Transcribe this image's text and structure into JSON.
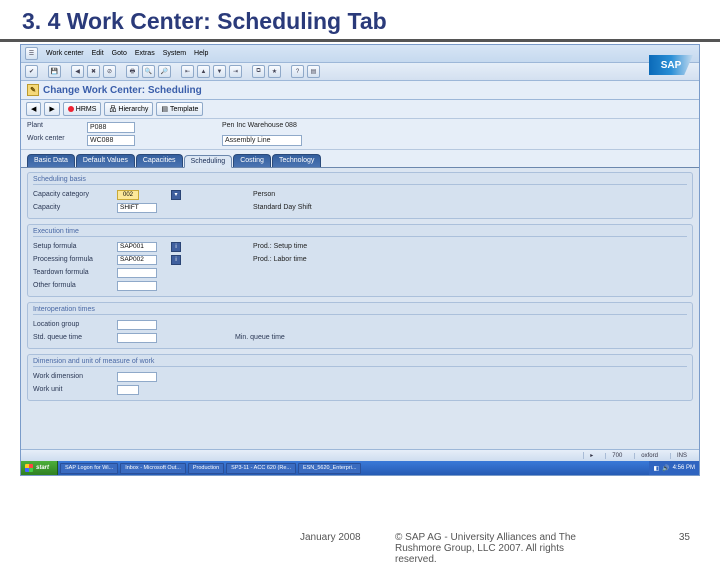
{
  "slide": {
    "title": "3. 4 Work Center: Scheduling Tab"
  },
  "menubar": {
    "sys_icon": "☰",
    "items": [
      "Work center",
      "Edit",
      "Goto",
      "Extras",
      "System",
      "Help"
    ]
  },
  "logo": "SAP",
  "page_header": {
    "icon_glyph": "✎",
    "title": "Change Work Center: Scheduling"
  },
  "actions": {
    "hrms": "HRMS",
    "hierarchy": "Hierarchy",
    "template": "Template"
  },
  "header_fields": {
    "plant_label": "Plant",
    "plant_value": "P088",
    "plant_desc": "Pen Inc Warehouse 088",
    "wc_label": "Work center",
    "wc_value": "WC088",
    "wc_desc": "Assembly Line"
  },
  "tabs": [
    "Basic Data",
    "Default Values",
    "Capacities",
    "Scheduling",
    "Costing",
    "Technology"
  ],
  "groups": {
    "sched": {
      "title": "Scheduling basis",
      "cap_cat_label": "Capacity category",
      "cap_cat_value": "002",
      "cap_cat_desc": "Person",
      "cap_label": "Capacity",
      "cap_value": "SHIFT",
      "cap_desc": "Standard Day Shift"
    },
    "exec": {
      "title": "Execution time",
      "setup_label": "Setup formula",
      "setup_value": "SAP001",
      "setup_desc": "Prod.: Setup time",
      "proc_label": "Processing formula",
      "proc_value": "SAP002",
      "proc_desc": "Prod.: Labor time",
      "teardown_label": "Teardown formula",
      "teardown_value": "",
      "other_label": "Other formula",
      "other_value": ""
    },
    "interop": {
      "title": "Interoperation times",
      "loc_label": "Location group",
      "loc_value": "",
      "queue_label": "Std. queue time",
      "queue_value": "",
      "queue_desc_label": "Min. queue time"
    },
    "dim": {
      "title": "Dimension and unit of measure of work",
      "wdim_label": "Work dimension",
      "wdim_value": "",
      "wunit_label": "Work unit",
      "wunit_value": ""
    }
  },
  "sap_status": {
    "arrow": "▸",
    "sess": "700",
    "client": "oxford",
    "ins": "INS"
  },
  "taskbar": {
    "start": "start",
    "items": [
      "SAP Logon for Wi...",
      "Inbox - Microsoft Out...",
      "Production",
      "SP3-11 - ACC 620 (Re...",
      "ESN_5620_Enterpri..."
    ],
    "time": "4:56 PM"
  },
  "footer": {
    "date": "January 2008",
    "copy": "© SAP AG - University Alliances and The Rushmore Group, LLC 2007. All rights reserved.",
    "page": "35"
  }
}
